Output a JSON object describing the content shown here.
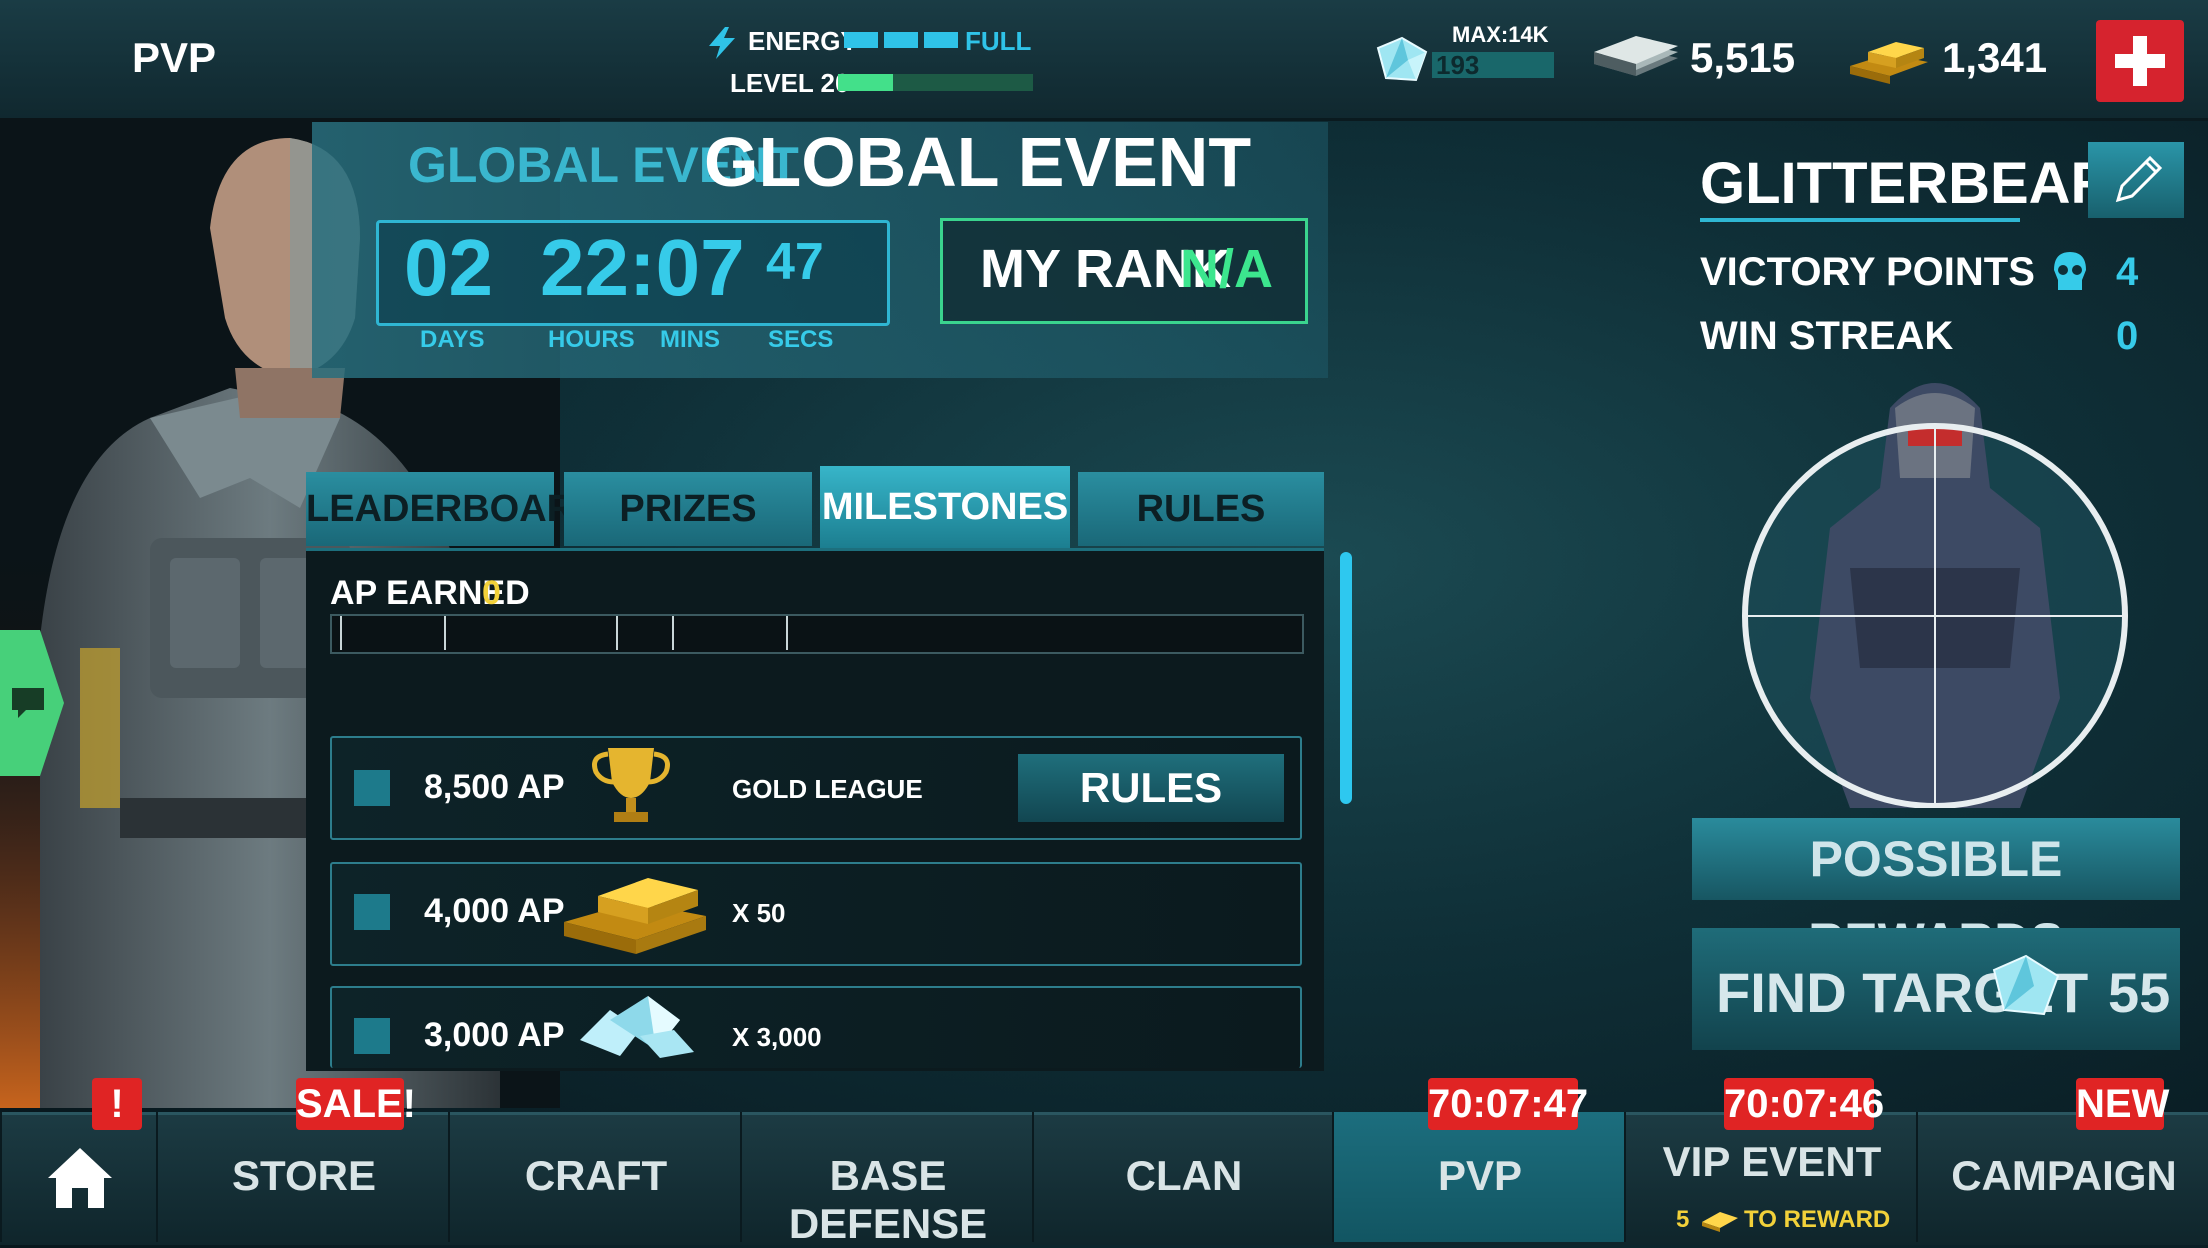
{
  "header": {
    "title": "PVP",
    "energy_label": "ENERGY",
    "energy_status": "FULL",
    "energy_segments": 3,
    "level_label": "LEVEL 20",
    "level_progress": 0.28,
    "crystals_max": "MAX:14K",
    "crystals": "193",
    "crystals_fill": 0.18,
    "cash": "5,515",
    "gold": "1,341"
  },
  "event": {
    "subtitle": "GLOBAL EVENT",
    "title": "GLOBAL EVENT",
    "timer": {
      "days": "02",
      "hours": "22:07",
      "secs": "47",
      "days_label": "DAYS",
      "hours_label": "HOURS",
      "mins_label": "MINS",
      "secs_label": "SECS"
    },
    "rank_label": "MY RANK",
    "rank_value": "N/A"
  },
  "tabs": [
    {
      "label": "LEADERBOARD"
    },
    {
      "label": "PRIZES"
    },
    {
      "label": "MILESTONES",
      "active": true
    },
    {
      "label": "RULES"
    }
  ],
  "milestones": {
    "ap_label": "AP EARNED",
    "ap_value": "0",
    "rows": [
      {
        "ap": "8,500 AP",
        "reward": "GOLD LEAGUE",
        "reward_icon": "trophy-icon",
        "button": "RULES"
      },
      {
        "ap": "4,000 AP",
        "reward": "X 50",
        "reward_icon": "gold-bars-icon"
      },
      {
        "ap": "3,000 AP",
        "reward": "X 3,000",
        "reward_icon": "crystals-icon"
      }
    ]
  },
  "player": {
    "name": "GLITTERBEARD",
    "victory_points_label": "VICTORY POINTS",
    "victory_points": "4",
    "win_streak_label": "WIN STREAK",
    "win_streak": "0",
    "possible_rewards": "POSSIBLE REWARDS",
    "find_target": "FIND TARGET",
    "find_target_cost": "55"
  },
  "nav": {
    "alert": "!",
    "items": [
      {
        "label": "STORE",
        "badge": "SALE!"
      },
      {
        "label": "CRAFT"
      },
      {
        "label": "BASE DEFENSE"
      },
      {
        "label": "CLAN"
      },
      {
        "label": "PVP",
        "badge": "70:07:47",
        "active": true
      },
      {
        "label": "VIP EVENT",
        "badge": "70:07:46",
        "sub_count": "5",
        "sub_text": "TO REWARD"
      },
      {
        "label": "CAMPAIGN",
        "badge": "NEW"
      }
    ]
  },
  "colors": {
    "accent": "#36cbe9",
    "rank_green": "#3ce68e",
    "ap_yellow": "#f2d13a",
    "badge_red": "#e02424"
  }
}
